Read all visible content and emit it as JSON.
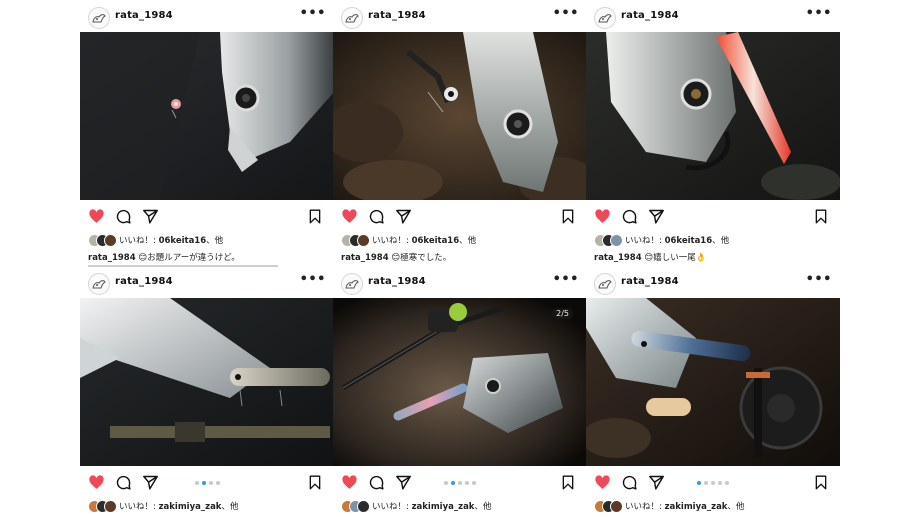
{
  "colors": {
    "heart": "#ed4956",
    "dot_active": "#3897f0",
    "dot_inactive": "#c9c9c9",
    "text": "#222222"
  },
  "icons": [
    "user-avatar-icon",
    "more-options-icon",
    "heart-icon",
    "comment-icon",
    "share-icon",
    "bookmark-icon"
  ],
  "posts": [
    {
      "username": "rata_1984",
      "more": "•••",
      "likes_prefix": "いいね！: ",
      "liker": "06keita16",
      "likes_suffix": "、他",
      "caption_user": "rata_1984",
      "caption_text": "😊お題ルアーが違うけど。",
      "counter": "",
      "carousel_dots": 0,
      "active_dot": 0
    },
    {
      "username": "rata_1984",
      "more": "•••",
      "likes_prefix": "いいね！: ",
      "liker": "06keita16",
      "likes_suffix": "、他",
      "caption_user": "rata_1984",
      "caption_text": "😊極寒でした。",
      "counter": "",
      "carousel_dots": 0,
      "active_dot": 0
    },
    {
      "username": "rata_1984",
      "more": "•••",
      "likes_prefix": "いいね！: ",
      "liker": "06keita16",
      "likes_suffix": "、他",
      "caption_user": "rata_1984",
      "caption_text": "😊嬉しい一尾👌",
      "counter": "",
      "carousel_dots": 0,
      "active_dot": 0
    },
    {
      "username": "rata_1984",
      "more": "•••",
      "likes_prefix": "いいね！: ",
      "liker": "zakimiya_zak",
      "likes_suffix": "、他",
      "caption_user": "",
      "caption_text": "",
      "counter": "",
      "carousel_dots": 4,
      "active_dot": 1
    },
    {
      "username": "rata_1984",
      "more": "•••",
      "likes_prefix": "いいね！: ",
      "liker": "zakimiya_zak",
      "likes_suffix": "、他",
      "caption_user": "",
      "caption_text": "",
      "counter": "2/5",
      "carousel_dots": 5,
      "active_dot": 1
    },
    {
      "username": "rata_1984",
      "more": "•••",
      "likes_prefix": "いいね！: ",
      "liker": "zakimiya_zak",
      "likes_suffix": "、他",
      "caption_user": "",
      "caption_text": "",
      "counter": "",
      "carousel_dots": 5,
      "active_dot": 0
    }
  ]
}
